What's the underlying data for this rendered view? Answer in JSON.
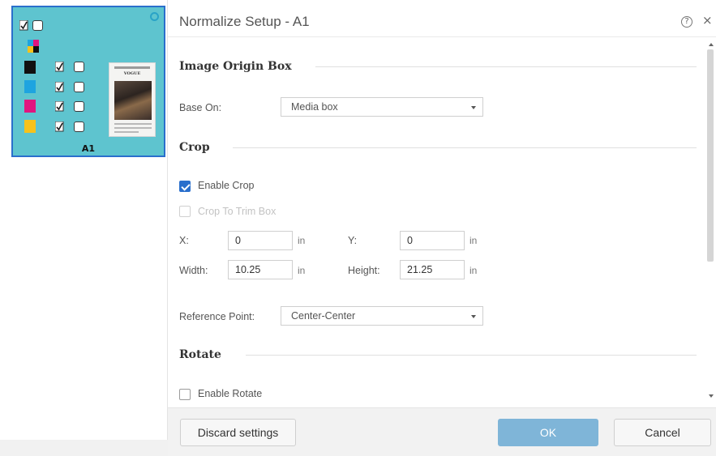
{
  "left_panel": {
    "page_label": "A1",
    "separations": [
      {
        "name": "black",
        "color": "#111111"
      },
      {
        "name": "cyan",
        "color": "#1ea4e0"
      },
      {
        "name": "magenta",
        "color": "#e0157f"
      },
      {
        "name": "yellow",
        "color": "#f7c21b"
      }
    ],
    "thumbnail_title": "VOGUE"
  },
  "dialog": {
    "title": "Normalize Setup - A1",
    "sections": {
      "image_origin": {
        "title": "Image Origin Box",
        "base_on_label": "Base On:",
        "base_on_value": "Media box"
      },
      "crop": {
        "title": "Crop",
        "enable_crop_label": "Enable Crop",
        "enable_crop_checked": true,
        "crop_to_trim_label": "Crop To Trim Box",
        "crop_to_trim_enabled": false,
        "x_label": "X:",
        "x_value": "0",
        "y_label": "Y:",
        "y_value": "0",
        "width_label": "Width:",
        "width_value": "10.25",
        "height_label": "Height:",
        "height_value": "21.25",
        "unit": "in",
        "reference_point_label": "Reference Point:",
        "reference_point_value": "Center-Center"
      },
      "rotate": {
        "title": "Rotate",
        "enable_rotate_label": "Enable Rotate",
        "enable_rotate_checked": false
      }
    },
    "footer": {
      "discard_label": "Discard settings",
      "ok_label": "OK",
      "cancel_label": "Cancel"
    }
  },
  "colors": {
    "page_card_bg": "#5ec4cf",
    "selection_border": "#2a6fcc",
    "primary_button": "#7fb5d8",
    "checkbox_checked": "#2a6fcc"
  }
}
